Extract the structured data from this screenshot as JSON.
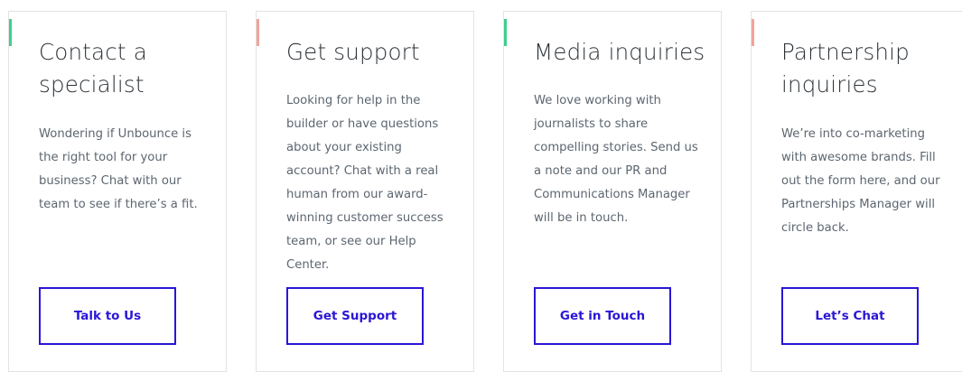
{
  "cards": [
    {
      "title": "Contact a specialist",
      "body": "Wondering if Unbounce is the right tool for your business? Chat with our team to see if there’s a fit.",
      "button_label": "Talk to Us",
      "accent_color": "#3ecf8e"
    },
    {
      "title": "Get support",
      "body": "Looking for help in the builder or have questions about your existing account? Chat with a real human from our award-winning customer success team, or see our Help Center.",
      "button_label": "Get Support",
      "accent_color": "#f2a39b"
    },
    {
      "title": "Media inquiries",
      "body": "We love working with journalists to share compelling stories. Send us a note and our PR and Communications Manager will be in touch.",
      "button_label": "Get in Touch",
      "accent_color": "#3ecf8e"
    },
    {
      "title": "Partnership inquiries",
      "body": "We’re into co-marketing with awesome brands. Fill out the form here, and our Partnerships Manager will circle back.",
      "button_label": "Let’s Chat",
      "accent_color": "#f2a39b"
    }
  ],
  "colors": {
    "button_border": "#2a16d6",
    "heading": "#2e3338",
    "body_text": "#5d6670"
  }
}
